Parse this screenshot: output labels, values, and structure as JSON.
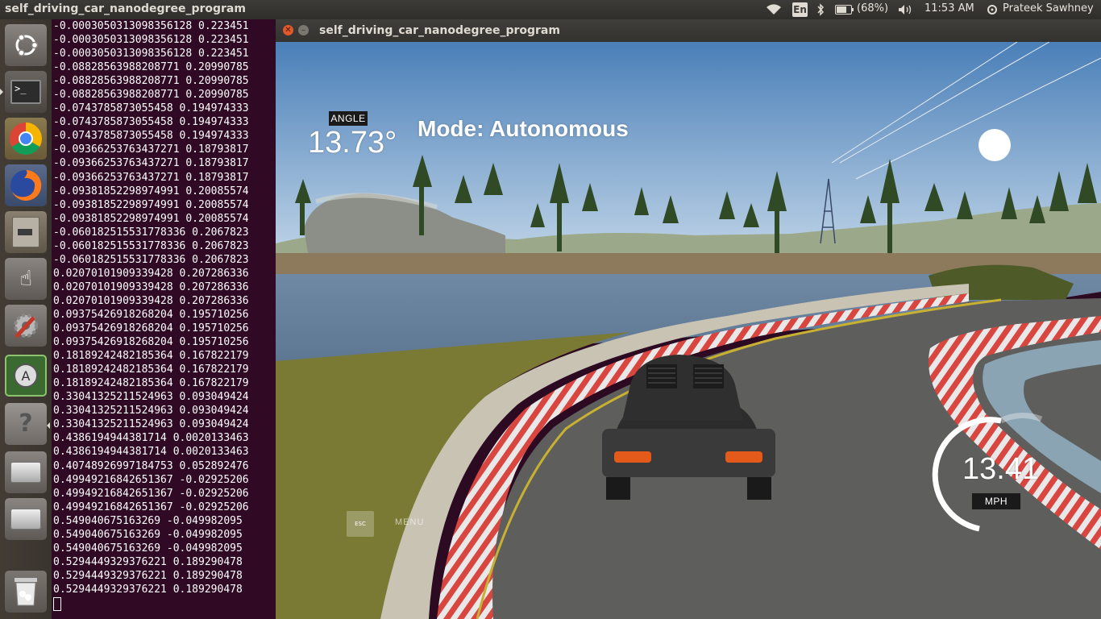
{
  "top_panel": {
    "app_title": "self_driving_car_nanodegree_program",
    "keyboard_layout": "En",
    "battery": "(68%)",
    "time": "11:53 AM",
    "user": "Prateek Sawhney"
  },
  "launcher": {
    "items": [
      {
        "name": "ubuntu-dash-icon"
      },
      {
        "name": "terminal-icon"
      },
      {
        "name": "chrome-icon"
      },
      {
        "name": "firefox-icon"
      },
      {
        "name": "files-icon"
      },
      {
        "name": "hand-pointer-icon"
      },
      {
        "name": "system-settings-icon"
      },
      {
        "name": "software-updater-icon"
      },
      {
        "name": "help-icon"
      },
      {
        "name": "drive-icon"
      },
      {
        "name": "drive-icon-2"
      },
      {
        "name": "trash-icon"
      }
    ]
  },
  "terminal": {
    "lines": [
      "-0.0003050313098356128 0.223451",
      "-0.0003050313098356128 0.223451",
      "-0.0003050313098356128 0.223451",
      "-0.08828563988208771 0.20990785",
      "-0.08828563988208771 0.20990785",
      "-0.08828563988208771 0.20990785",
      "-0.0743785873055458 0.194974333",
      "-0.0743785873055458 0.194974333",
      "-0.0743785873055458 0.194974333",
      "-0.09366253763437271 0.18793817",
      "-0.09366253763437271 0.18793817",
      "-0.09366253763437271 0.18793817",
      "-0.09381852298974991 0.20085574",
      "-0.09381852298974991 0.20085574",
      "-0.09381852298974991 0.20085574",
      "-0.060182515531778336 0.2067823",
      "-0.060182515531778336 0.2067823",
      "-0.060182515531778336 0.2067823",
      "0.02070101909339428 0.207286336",
      "0.02070101909339428 0.207286336",
      "0.02070101909339428 0.207286336",
      "0.09375426918268204 0.195710256",
      "0.09375426918268204 0.195710256",
      "0.09375426918268204 0.195710256",
      "0.18189242482185364 0.167822179",
      "0.18189242482185364 0.167822179",
      "0.18189242482185364 0.167822179",
      "0.33041325211524963 0.093049424",
      "0.33041325211524963 0.093049424",
      "0.33041325211524963 0.093049424",
      "0.4386194944381714 0.0020133463",
      "0.4386194944381714 0.0020133463",
      "0.40748926997184753 0.052892476",
      "0.49949216842651367 -0.02925206",
      "0.49949216842651367 -0.02925206",
      "0.49949216842651367 -0.02925206",
      "0.549040675163269 -0.049982095",
      "0.549040675163269 -0.049982095",
      "0.549040675163269 -0.049982095",
      "0.5294449329376221 0.189290478",
      "0.5294449329376221 0.189290478",
      "0.5294449329376221 0.189290478"
    ]
  },
  "simulator": {
    "window_title": "self_driving_car_nanodegree_program",
    "angle_label": "ANGLE",
    "angle_value": "13.73°",
    "mode_text": "Mode: Autonomous",
    "speed_value": "13.41",
    "speed_unit": "MPH",
    "esc_label": "ESC",
    "menu_label": "MENU"
  },
  "colors": {
    "terminal_bg": "#300a24",
    "panel_bg": "#3c3b37",
    "close_button": "#e0592a"
  }
}
